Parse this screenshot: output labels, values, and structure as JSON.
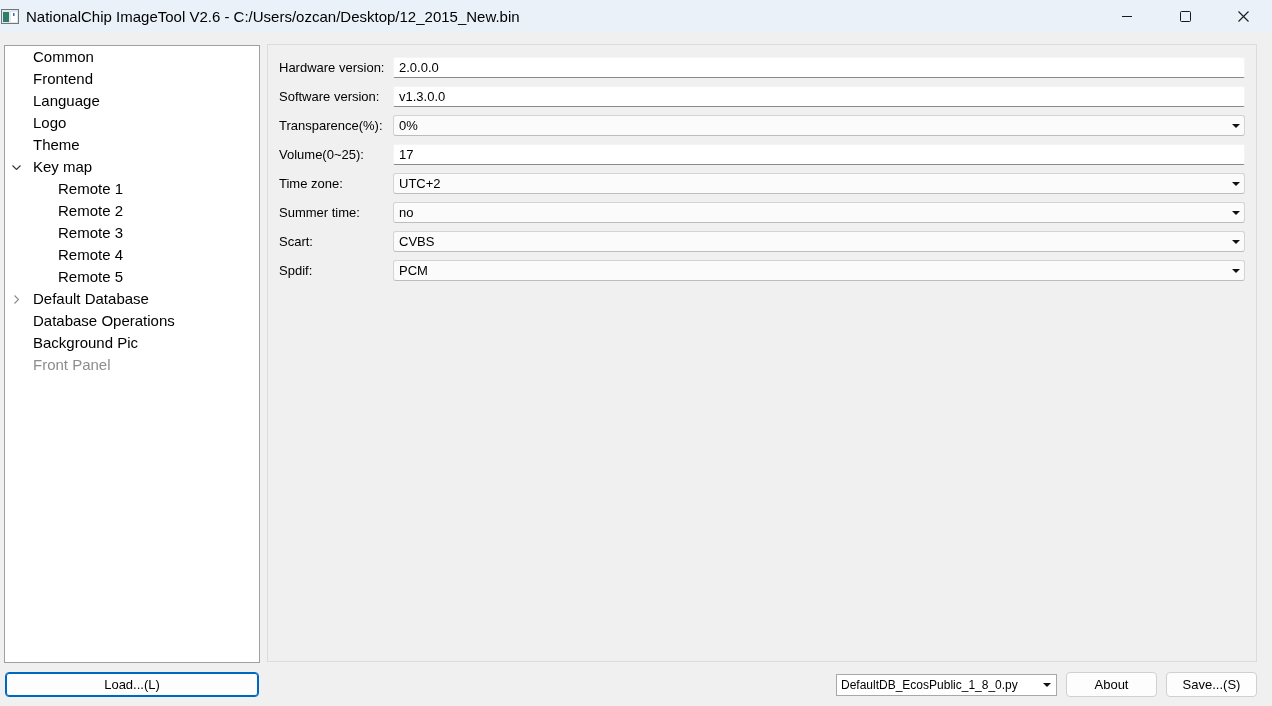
{
  "window": {
    "title": "NationalChip ImageTool V2.6 - C:/Users/ozcan/Desktop/12_2015_New.bin"
  },
  "tree": {
    "items": [
      {
        "label": "Common",
        "disabled": false
      },
      {
        "label": "Frontend",
        "disabled": false
      },
      {
        "label": "Language",
        "disabled": false
      },
      {
        "label": "Logo",
        "disabled": false
      },
      {
        "label": "Theme",
        "disabled": false
      },
      {
        "label": "Key map",
        "disabled": false,
        "expanded": true,
        "children": [
          {
            "label": "Remote 1",
            "disabled": false
          },
          {
            "label": "Remote 2",
            "disabled": false
          },
          {
            "label": "Remote 3",
            "disabled": false
          },
          {
            "label": "Remote 4",
            "disabled": false
          },
          {
            "label": "Remote 5",
            "disabled": false
          }
        ]
      },
      {
        "label": "Default Database",
        "disabled": false,
        "expanded": false
      },
      {
        "label": "Database Operations",
        "disabled": false
      },
      {
        "label": "Background Pic",
        "disabled": false
      },
      {
        "label": "Front Panel",
        "disabled": true
      }
    ]
  },
  "settings": {
    "fields": [
      {
        "label": "Hardware version:",
        "kind": "text",
        "value": "2.0.0.0"
      },
      {
        "label": "Software version:",
        "kind": "text",
        "value": "v1.3.0.0"
      },
      {
        "label": "Transparence(%):",
        "kind": "combo",
        "value": "0%"
      },
      {
        "label": "Volume(0~25):",
        "kind": "text",
        "value": "17"
      },
      {
        "label": "Time zone:",
        "kind": "combo",
        "value": "UTC+2"
      },
      {
        "label": "Summer time:",
        "kind": "combo",
        "value": "no"
      },
      {
        "label": "Scart:",
        "kind": "combo",
        "value": "CVBS"
      },
      {
        "label": "Spdif:",
        "kind": "combo",
        "value": "PCM"
      }
    ]
  },
  "footer": {
    "load_button": {
      "label": "Load...(L)",
      "focused": true
    },
    "script_select": {
      "value": "DefaultDB_EcosPublic_1_8_0.py"
    },
    "buttons": [
      {
        "label": "About",
        "focused": false
      },
      {
        "label": "Save...(S)",
        "focused": false
      }
    ]
  }
}
